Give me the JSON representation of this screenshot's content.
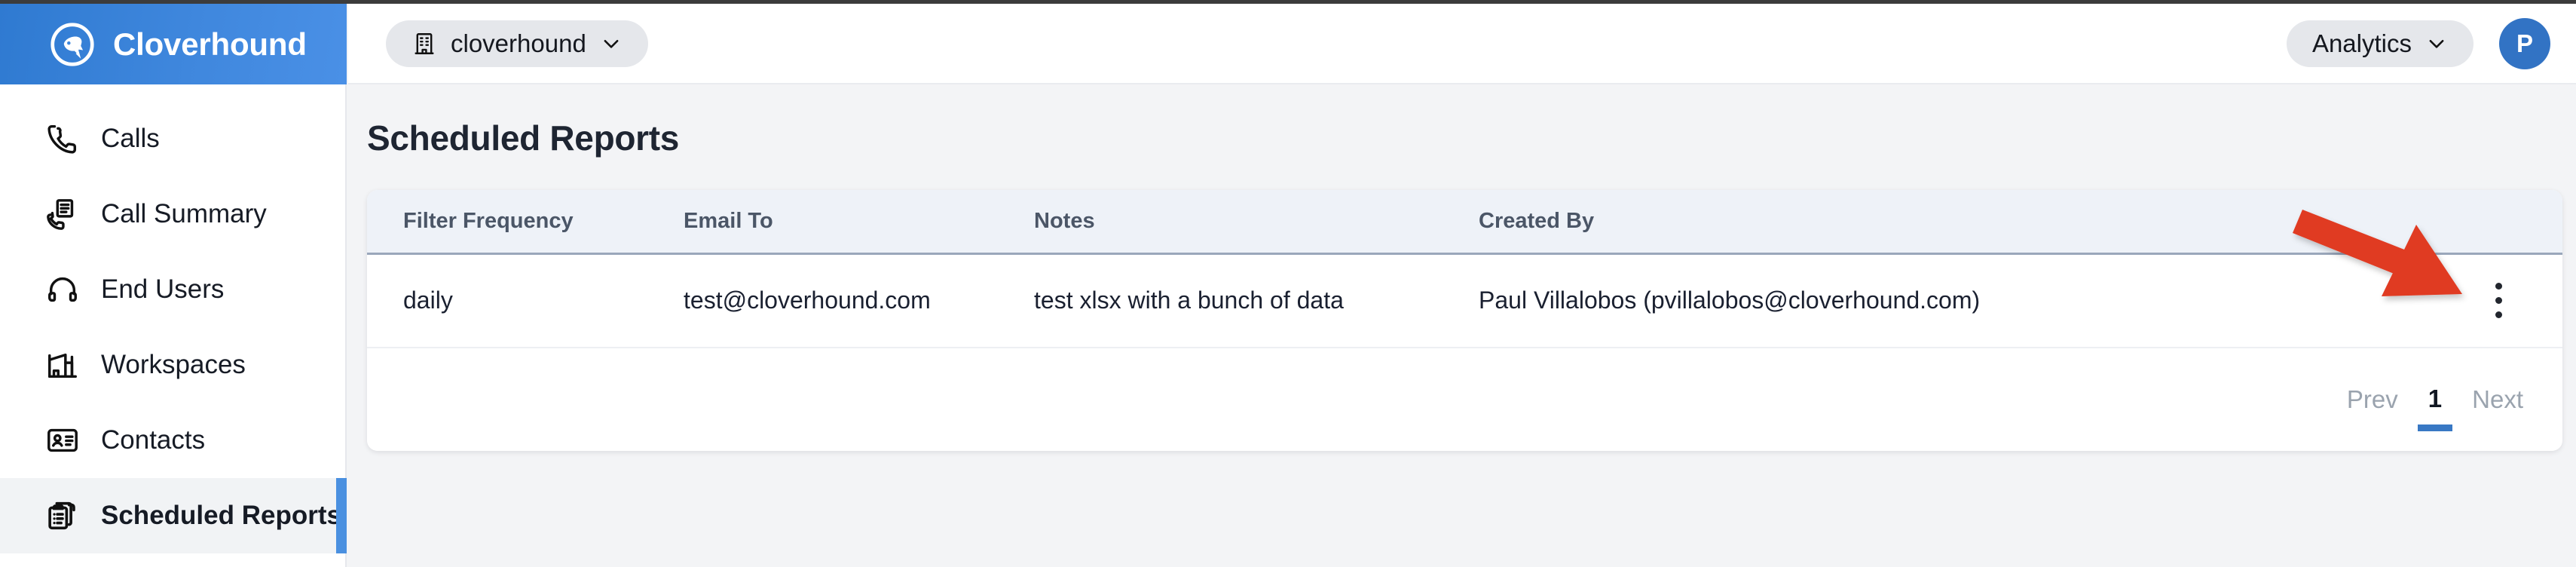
{
  "brand": {
    "name": "Cloverhound",
    "logo_icon": "hound-logo-icon",
    "bg_color": "#3f87dd"
  },
  "sidebar": {
    "items": [
      {
        "label": "Calls",
        "icon": "phone-icon",
        "active": false
      },
      {
        "label": "Call Summary",
        "icon": "phone-document-icon",
        "active": false
      },
      {
        "label": "End Users",
        "icon": "headset-icon",
        "active": false
      },
      {
        "label": "Workspaces",
        "icon": "factory-building-icon",
        "active": false
      },
      {
        "label": "Contacts",
        "icon": "contact-card-icon",
        "active": false
      },
      {
        "label": "Scheduled Reports",
        "icon": "clipboard-list-icon",
        "active": true
      }
    ],
    "active_indicator_color": "#4a90e0"
  },
  "topbar": {
    "tenant": {
      "label": "cloverhound",
      "icon": "building-icon",
      "chevron": "chevron-down-icon"
    },
    "section": {
      "label": "Analytics",
      "chevron": "chevron-down-icon"
    },
    "avatar": {
      "initial": "P",
      "color": "#3273c4"
    }
  },
  "main": {
    "page_title": "Scheduled Reports",
    "table": {
      "columns": [
        "Filter Frequency",
        "Email To",
        "Notes",
        "Created By",
        ""
      ],
      "rows": [
        {
          "filter_frequency": "daily",
          "email_to": "test@cloverhound.com",
          "notes": "test xlsx with a bunch of data",
          "created_by": "Paul Villalobos (pvillalobos@cloverhound.com)",
          "row_menu_icon": "kebab-menu-icon"
        }
      ]
    },
    "pagination": {
      "prev_label": "Prev",
      "current_page": "1",
      "next_label": "Next",
      "active_underline_color": "#3878c4"
    }
  },
  "annotation": {
    "arrow_color": "#e03b24",
    "points_to": "row-kebab-menu"
  }
}
